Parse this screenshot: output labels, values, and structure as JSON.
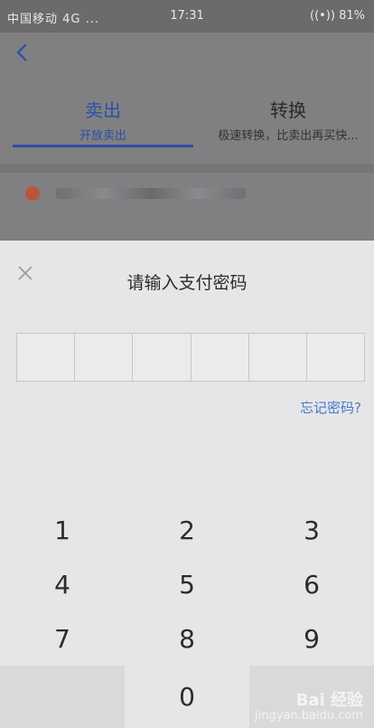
{
  "status_bar": {
    "left": "中国移动 4G ...",
    "time": "17:31",
    "battery": "81%"
  },
  "background_page": {
    "tabs": [
      {
        "title": "卖出",
        "subtitle": "开放卖出"
      },
      {
        "title": "转换",
        "subtitle": "极速转换，比卖出再买快..."
      }
    ]
  },
  "password_sheet": {
    "title": "请输入支付密码",
    "forgot_link": "忘记密码?",
    "pin_length": 6
  },
  "keypad": {
    "keys": [
      "1",
      "2",
      "3",
      "4",
      "5",
      "6",
      "7",
      "8",
      "9",
      "",
      "0",
      ""
    ]
  },
  "watermark": {
    "brand": "Bai 经验",
    "url": "jingyan.baidu.com"
  },
  "colors": {
    "accent": "#2d4fa3",
    "link": "#4a78c8"
  }
}
